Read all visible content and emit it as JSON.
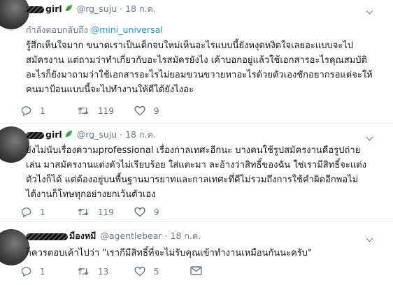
{
  "tweets": [
    {
      "name_visible": "girl",
      "handle": "@rg_suju",
      "date": "18 ก.ค.",
      "replying_prefix": "กำลังตอบกลับถึง",
      "replying_to": "@mini_universal",
      "lines": [
        "รู้สึกเห็นใจมาก ขนาดเราเป็นเด็กจบใหม่เห็นอะไรแบบนี้ยังหงุดหงิดใจเลยอะแบบจะไป",
        "สมัครงาน แต่ถามว่าทำเกี่ยวกับอะไรสมัครยังไง เค้าบอกอยู่แล้วใช้เอกสารอะไรคุณสมบัติ",
        "อะไรก็ยังมาถามว่าใช้เอกสารอะไรไม่ยอมขวนขวายหาอะไรด้วยตัวเองชักอยากรอแต่จะให้",
        "คนมาป้อนแบบนี้จะไปทำงานให้ดีได้ยังไงอะ"
      ],
      "replies": "1",
      "retweets": "119",
      "likes": "9"
    },
    {
      "name_visible": "girl",
      "handle": "@rg_suju",
      "date": "18 ก.ค.",
      "lines": [
        "ยังไม่นับเรื่องความprofessional เรื่องกาลเทศะอีกนะ บางคนใช้รูปสมัครงานคือรูปถ่าย",
        "เล่น มาสมัครงานแต่งตัวไม่เรียบร้อย ใส่แตะมา ละอ้างว่าสิทธิ์ของฉัน ใช่เรามีสิทธิ์จะแต่ง",
        "ตัวไงก็ได้ แต่ต้องอยู่บนพื้นฐานมารยาทและกาลเทศะที่ดีไม่รวมถึงการใช้คำผิดอีกพอไม่",
        "ได้งานก็โทษทุกอย่างยกเว้นตัวเอง"
      ],
      "replies": "1",
      "retweets": "119",
      "likes": "9"
    },
    {
      "name_visible": "มืองหมี",
      "handle": "@agentlebear",
      "date": "18 ก.ค.",
      "lines": [
        "ก็ควรตอบเค้าไปว่า \"เรากีมีสิทธิ์ที่จะไม่รับคุณเข้าทำงานเหมือนกันนะครับ\""
      ],
      "replies": "1",
      "retweets": "13",
      "likes": "5"
    }
  ],
  "icons": {
    "caret": "chevron-down-icon",
    "reply": "reply-icon",
    "retweet": "retweet-icon",
    "like": "heart-icon",
    "dm": "envelope-icon",
    "badge": "leaf-icon"
  },
  "colors": {
    "text": "#14171a",
    "muted": "#657786",
    "link": "#1b95e0",
    "border": "#e6ecf0"
  }
}
